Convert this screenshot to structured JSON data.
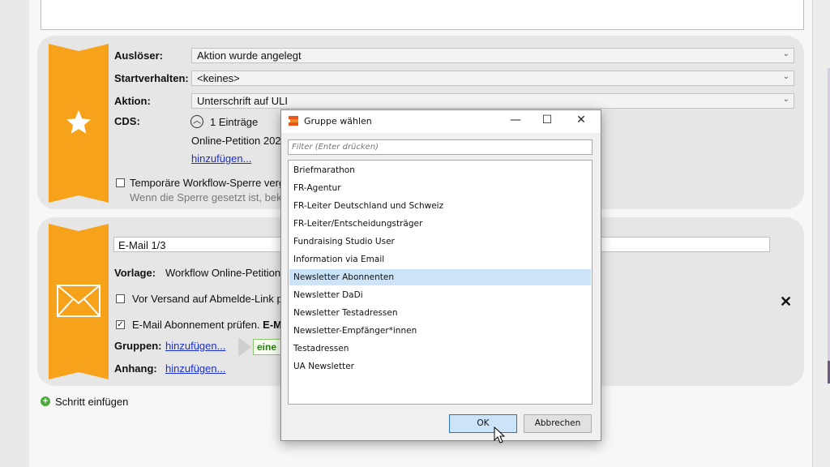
{
  "step1": {
    "trigger_label": "Auslöser:",
    "trigger_value": "Aktion wurde angelegt",
    "start_label": "Startverhalten:",
    "start_value": "<keines>",
    "action_label": "Aktion:",
    "action_value": "Unterschrift auf ULI",
    "cds_label": "CDS:",
    "cds_count": "1 Einträge",
    "cds_entry": "Online-Petition 202",
    "add_link": "hinzufügen...",
    "lock_label": "Temporäre Workflow-Sperre verg",
    "lock_hint": "Wenn die Sperre gesetzt ist, bek",
    "icon": "star-icon"
  },
  "step2": {
    "title_value": "E-Mail 1/3",
    "template_label": "Vorlage:",
    "template_value": "Workflow Online-Petition",
    "unsubscribe_label": "Vor Versand auf Abmelde-Link p",
    "subscription_label": "E-Mail Abonnement prüfen.",
    "subscription_bold": "E-M",
    "groups_label": "Gruppen:",
    "groups_link": "hinzufügen...",
    "groups_tag": "eine",
    "attachment_label": "Anhang:",
    "attachment_link": "hinzufügen...",
    "icon": "envelope-icon",
    "close_glyph": "✕"
  },
  "add_step_label": "Schritt einfügen",
  "dialog": {
    "title": "Gruppe wählen",
    "filter_placeholder": "Filter (Enter drücken)",
    "items": [
      "Briefmarathon",
      "FR-Agentur",
      "FR-Leiter Deutschland und Schweiz",
      "FR-Leiter/Entscheidungsträger",
      "Fundraising Studio User",
      "Information via Email",
      "Newsletter Abonnenten",
      "Newsletter DaDi",
      "Newsletter Testadressen",
      "Newsletter-Empfänger*innen",
      "Testadressen",
      "UA Newsletter"
    ],
    "selected_index": 6,
    "ok_label": "OK",
    "cancel_label": "Abbrechen"
  },
  "colors": {
    "ribbon": "#f7a21b",
    "link": "#1a2fd0",
    "selection": "#cce4f7"
  }
}
